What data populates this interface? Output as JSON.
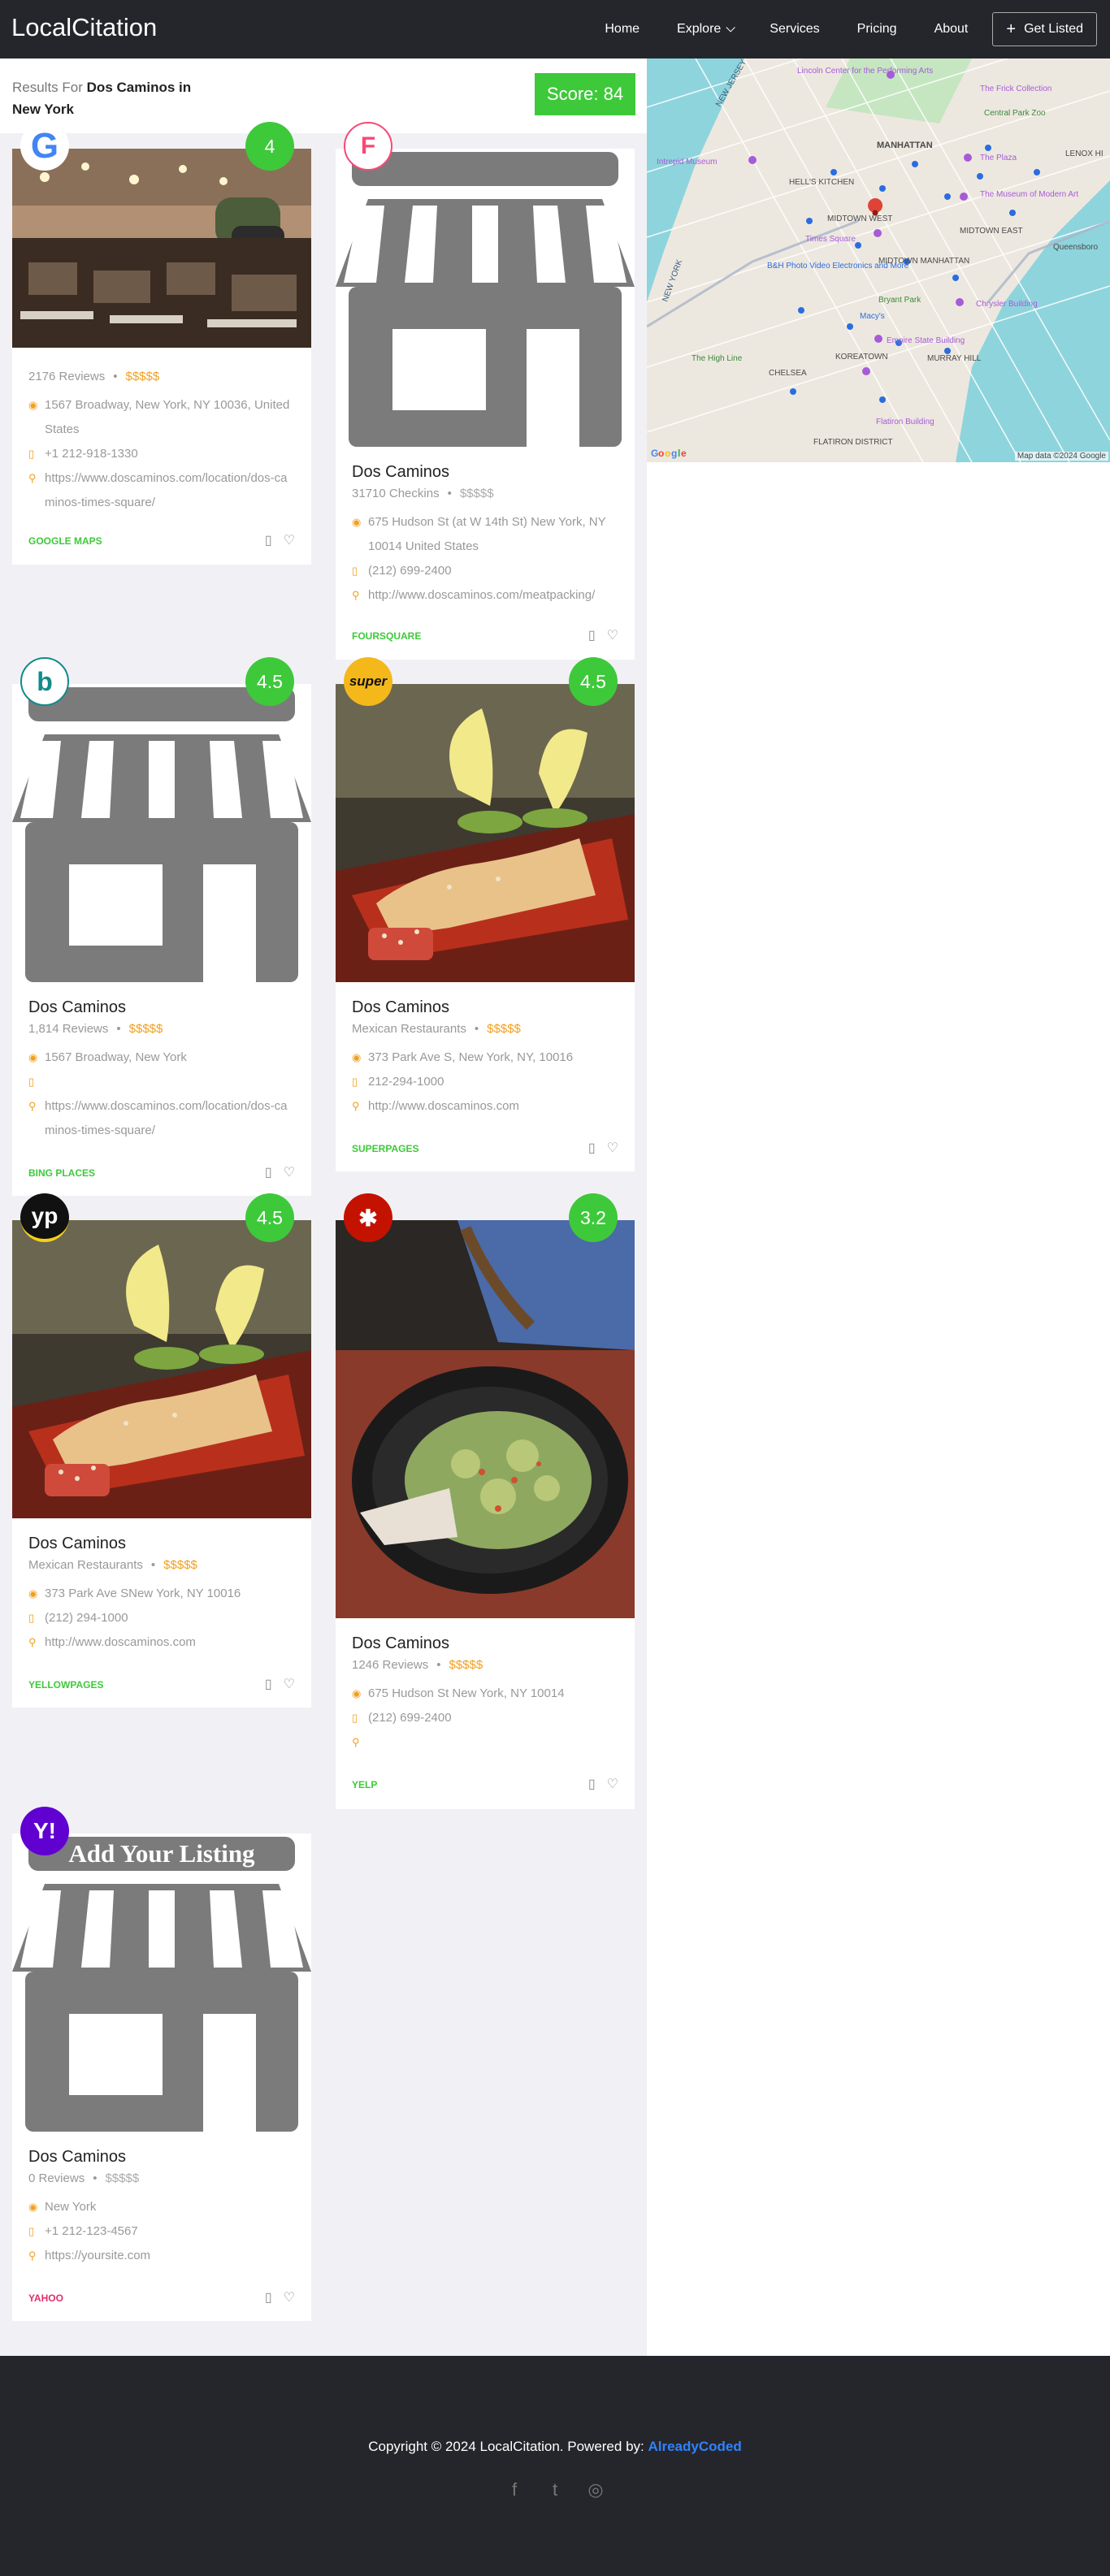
{
  "nav": {
    "logo": "LocalCitation",
    "links": [
      "Home",
      "Explore",
      "Services",
      "Pricing",
      "About"
    ],
    "get_listed": "Get Listed"
  },
  "results": {
    "prefix": "Results For",
    "query": "Dos Caminos in New York",
    "score": "Score: 84"
  },
  "map": {
    "credit": "Map data ©2024 Google",
    "labels": [
      "MANHATTAN",
      "HELL'S KITCHEN",
      "MIDTOWN WEST",
      "MIDTOWN MANHATTAN",
      "MIDTOWN EAST",
      "KOREATOWN",
      "MURRAY HILL",
      "CHELSEA",
      "FLATIRON DISTRICT",
      "Times Square",
      "Bryant Park",
      "The Plaza",
      "Central Park Zoo",
      "Intrepid Museum",
      "The Museum of Modern Art",
      "Chrysler Building",
      "Empire State Building",
      "Macy's",
      "Flatiron Building",
      "The High Line",
      "Lincoln Center for the Performing Arts",
      "The Frick Collection",
      "Queensboro",
      "LENOX HI",
      "NEW JERSEY",
      "NEW YORK",
      "B&H Photo Video Electronics and More"
    ]
  },
  "cards": [
    {
      "source": "GOOGLE MAPS",
      "rating": "4",
      "title": "",
      "meta_count": "2176 Reviews",
      "price": "$$$$$",
      "address": "1567 Broadway, New York, NY 10036, United States",
      "phone": "+1 212-918-1330",
      "url": "https://www.doscaminos.com/location/dos-caminos-times-square/"
    },
    {
      "source": "FOURSQUARE",
      "rating": "",
      "title": "Dos Caminos",
      "meta_count": "31710 Checkins",
      "price": "$$$$$",
      "address": "675 Hudson St (at W 14th St) New York, NY 10014 United States",
      "phone": "(212) 699-2400",
      "url": "http://www.doscaminos.com/meatpacking/"
    },
    {
      "source": "BING PLACES",
      "rating": "4.5",
      "title": "Dos Caminos",
      "meta_count": "1,814 Reviews",
      "price": "$$$$$",
      "address": "1567 Broadway, New York",
      "phone": "",
      "url": "https://www.doscaminos.com/location/dos-caminos-times-square/"
    },
    {
      "source": "SUPERPAGES",
      "rating": "4.5",
      "title": "Dos Caminos",
      "meta_count": "Mexican Restaurants",
      "price": "$$$$$",
      "address": "373 Park Ave S, New York, NY, 10016",
      "phone": "212-294-1000",
      "url": "http://www.doscaminos.com"
    },
    {
      "source": "YELLOWPAGES",
      "rating": "4.5",
      "title": "Dos Caminos",
      "meta_count": "Mexican Restaurants",
      "price": "$$$$$",
      "address": "373 Park Ave SNew York, NY 10016",
      "phone": "(212) 294-1000",
      "url": "http://www.doscaminos.com"
    },
    {
      "source": "YELP",
      "rating": "3.2",
      "title": "Dos Caminos",
      "meta_count": "1246 Reviews",
      "price": "$$$$$",
      "address": "675 Hudson St New York, NY 10014",
      "phone": "(212) 699-2400",
      "url": ""
    },
    {
      "source": "YAHOO",
      "rating": "",
      "title": "Dos Caminos",
      "meta_count": "0 Reviews",
      "price": "$$$$$",
      "address": "New York",
      "phone": "+1 212-123-4567",
      "url": "https://yoursite.com",
      "banner": "Add Your Listing"
    }
  ],
  "footer": {
    "copyright": "Copyright © 2024 LocalCitation. Powered by:",
    "powered_by": "AlreadyCoded",
    "socials": [
      "facebook-icon",
      "twitter-icon",
      "instagram-icon"
    ]
  },
  "colors": {
    "nav_bg": "#25262b",
    "accent_green": "#3ec93a",
    "price_orange": "#f0a020",
    "link_blue": "#2f82ff"
  }
}
